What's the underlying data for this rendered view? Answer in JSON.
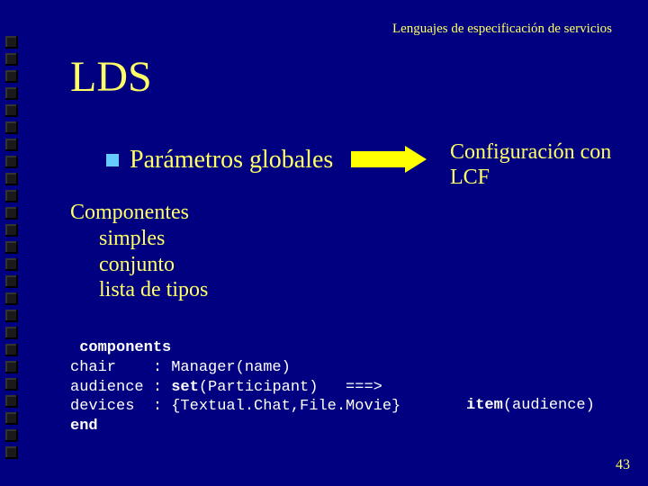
{
  "header": "Lenguajes de especificación de servicios",
  "title": "LDS",
  "bullet": "Parámetros globales",
  "config": {
    "line1": "Configuración con",
    "line2": "LCF"
  },
  "componentes": {
    "head": "Componentes",
    "i1": "simples",
    "i2": "conjunto",
    "i3": "lista de tipos"
  },
  "code": {
    "kw1": "components",
    "l1": "chair    : Manager(name)",
    "l2a": "audience : ",
    "kw_set": "set",
    "l2b": "(Participant)   ===>",
    "l3": "devices  : {Textual.Chat,File.Movie}",
    "kw2": "end"
  },
  "item": {
    "kw": "item",
    "rest": "(audience)"
  },
  "page": "43"
}
